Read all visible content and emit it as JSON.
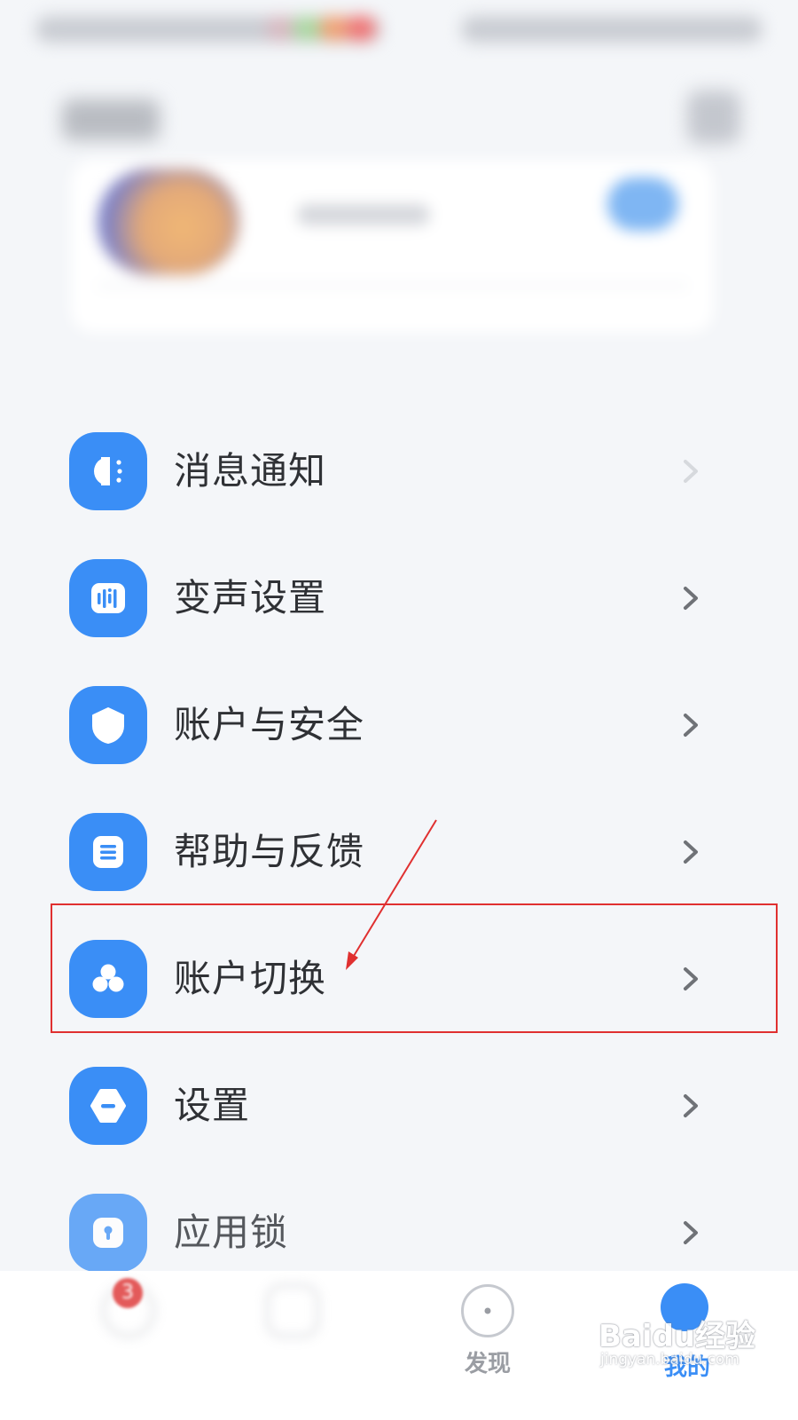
{
  "theme": {
    "accent": "#3a8ef6",
    "highlight": "#e03030",
    "text": "#2f3135"
  },
  "menu": {
    "items": [
      {
        "id": "notifications",
        "label": "消息通知",
        "icon": "notification-icon"
      },
      {
        "id": "voice-changer",
        "label": "变声设置",
        "icon": "voice-changer-icon"
      },
      {
        "id": "account-security",
        "label": "账户与安全",
        "icon": "shield-icon"
      },
      {
        "id": "help-feedback",
        "label": "帮助与反馈",
        "icon": "document-icon"
      },
      {
        "id": "account-switch",
        "label": "账户切换",
        "icon": "account-switch-icon",
        "highlighted": true
      },
      {
        "id": "settings",
        "label": "设置",
        "icon": "settings-icon"
      },
      {
        "id": "app-lock",
        "label": "应用锁",
        "icon": "lock-icon"
      }
    ]
  },
  "bottom_nav": {
    "badge_count": "3",
    "discover_label": "发现",
    "me_label": "我的"
  },
  "watermark": {
    "text": "Baidu经验",
    "sub": "jingyan.baidu.com"
  }
}
